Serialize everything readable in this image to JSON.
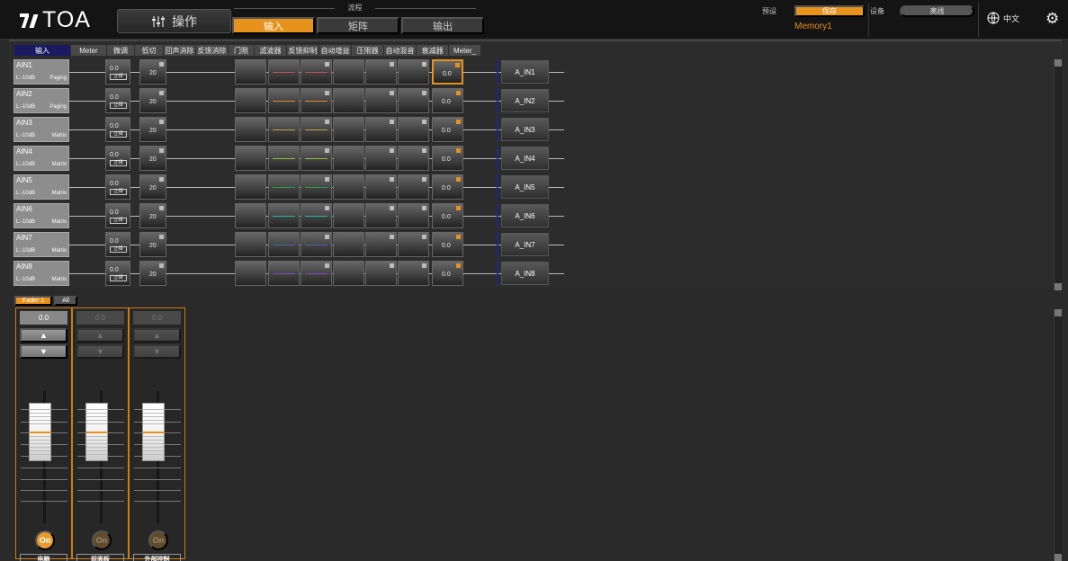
{
  "app": {
    "brand": "TOA",
    "mode": "操作"
  },
  "flow": {
    "label": "流程",
    "tabs": [
      "输入",
      "矩阵",
      "输出"
    ]
  },
  "preset": {
    "label": "预设",
    "save": "保存",
    "memory": "Memory1"
  },
  "device": {
    "label": "设备",
    "status": "离线"
  },
  "language": {
    "label": "中文"
  },
  "processing": {
    "headers": [
      "输入",
      "Meter",
      "微调",
      "低切",
      "回声消除",
      "反馈消除",
      "门限",
      "滤波器",
      "反馈抑制",
      "自动增益",
      "压限器",
      "自动混音",
      "衰减器",
      "Meter_"
    ],
    "rows": [
      {
        "name": "AIN1",
        "level": "L:-10dB",
        "mode": "Paging",
        "trim": "0.0",
        "phase": "正相",
        "lowcut": "20",
        "atten": "0.0",
        "output": "A_IN1",
        "color": "#c75353"
      },
      {
        "name": "AIN2",
        "level": "L:-10dB",
        "mode": "Paging",
        "trim": "0.0",
        "phase": "正相",
        "lowcut": "20",
        "atten": "0.0",
        "output": "A_IN2",
        "color": "#e78a2b"
      },
      {
        "name": "AIN3",
        "level": "L:-10dB",
        "mode": "Matrix",
        "trim": "0.0",
        "phase": "正相",
        "lowcut": "20",
        "atten": "0.0",
        "output": "A_IN3",
        "color": "#c7a044"
      },
      {
        "name": "AIN4",
        "level": "L:-10dB",
        "mode": "Matrix",
        "trim": "0.0",
        "phase": "正相",
        "lowcut": "20",
        "atten": "0.0",
        "output": "A_IN4",
        "color": "#92c246"
      },
      {
        "name": "AIN5",
        "level": "L:-10dB",
        "mode": "Matrix",
        "trim": "0.0",
        "phase": "正相",
        "lowcut": "20",
        "atten": "0.0",
        "output": "A_IN5",
        "color": "#2f9b47"
      },
      {
        "name": "AIN6",
        "level": "L:-10dB",
        "mode": "Matrix",
        "trim": "0.0",
        "phase": "正相",
        "lowcut": "20",
        "atten": "0.0",
        "output": "A_IN6",
        "color": "#20b7b1"
      },
      {
        "name": "AIN7",
        "level": "L:-10dB",
        "mode": "Matrix",
        "trim": "0.0",
        "phase": "正相",
        "lowcut": "20",
        "atten": "0.0",
        "output": "A_IN7",
        "color": "#4667b4"
      },
      {
        "name": "AIN8",
        "level": "L:-10dB",
        "mode": "Matrix",
        "trim": "0.0",
        "phase": "正相",
        "lowcut": "20",
        "atten": "0.0",
        "output": "A_IN8",
        "color": "#8c49c2"
      }
    ]
  },
  "fader_section": {
    "tabs": [
      "Fader 1",
      "All"
    ],
    "faders": [
      {
        "value": "0.0",
        "name": "电脑",
        "state": "On",
        "enabled": true
      },
      {
        "value": "0.0",
        "name": "前面板",
        "state": "On",
        "enabled": false
      },
      {
        "value": "0.0",
        "name": "外部控制",
        "state": "On",
        "enabled": false
      }
    ]
  },
  "colors": {
    "accent": "#e8921e",
    "header_active": "#181b62",
    "background": "#2a2a2a"
  }
}
